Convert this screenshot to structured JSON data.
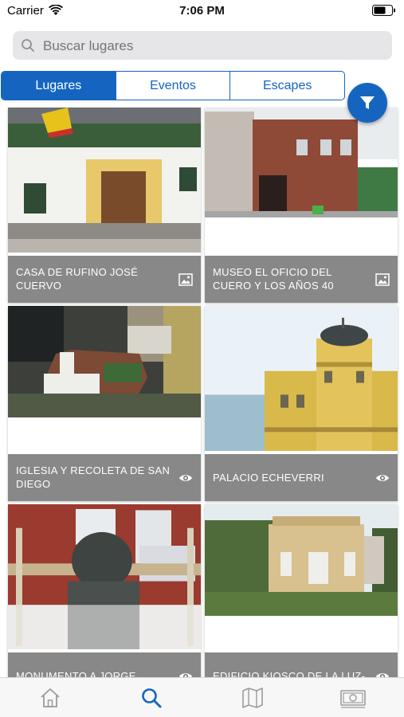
{
  "status_bar": {
    "carrier": "Carrier",
    "time": "7:06 PM"
  },
  "search": {
    "placeholder": "Buscar lugares"
  },
  "segments": [
    "Lugares",
    "Eventos",
    "Escapes"
  ],
  "active_segment": "Lugares",
  "filter_button": {
    "icon": "filter-icon"
  },
  "places": [
    {
      "name": "CASA DE RUFINO JOSÉ CUERVO",
      "icon": "image-icon"
    },
    {
      "name": "MUSEO EL OFICIO DEL CUERO Y LOS AÑOS 40",
      "icon": "image-icon"
    },
    {
      "name": "IGLESIA Y RECOLETA DE SAN DIEGO",
      "icon": "eye-icon"
    },
    {
      "name": "PALACIO ECHEVERRI",
      "icon": "eye-icon"
    },
    {
      "name": "MONUMENTO A JORGE",
      "icon": "eye-icon"
    },
    {
      "name": "EDIFICIO KIOSCO DE LA LUZ-",
      "icon": "eye-icon"
    }
  ],
  "tab_bar": {
    "items": [
      "home-icon",
      "search-icon",
      "map-icon",
      "money-icon"
    ],
    "active": "search-icon"
  },
  "colors": {
    "accent": "#1565c0",
    "caption_bg": "#6e6e6e",
    "tab_inactive": "#9b9b9b"
  }
}
